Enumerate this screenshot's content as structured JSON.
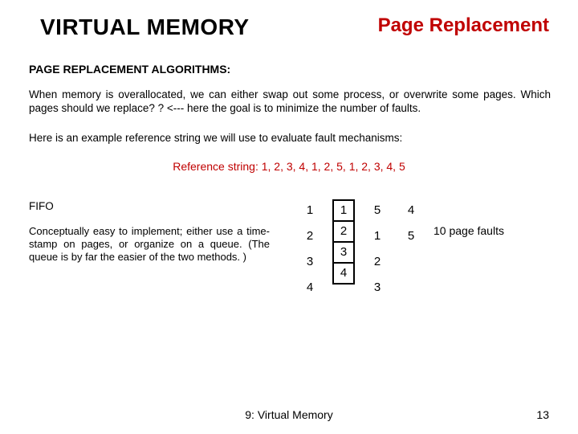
{
  "header": {
    "left": "VIRTUAL MEMORY",
    "right": "Page Replacement"
  },
  "section_heading": "PAGE REPLACEMENT ALGORITHMS:",
  "para1": "When memory is overallocated, we can either swap out some process, or overwrite some pages. Which pages should we replace? ? <--- here the goal is to minimize the number of faults.",
  "para_intro": "Here is an example reference string we will use to evaluate fault mechanisms:",
  "ref_string": "Reference string: 1, 2, 3, 4, 1, 2, 5, 1, 2, 3, 4, 5",
  "fifo": {
    "label": "FIFO",
    "desc": "Conceptually easy to implement; either use a time-stamp on pages, or organize on a queue.   (The queue is by far the easier of the two methods. )"
  },
  "cols": {
    "c0": [
      "1",
      "2",
      "3",
      "4"
    ],
    "c1": [
      "1",
      "2",
      "3",
      "4"
    ],
    "c2": [
      "5",
      "1",
      "2",
      "3"
    ],
    "c3": [
      "4",
      "5",
      "",
      ""
    ]
  },
  "fault_label": "10 page faults",
  "footer_center": "9: Virtual Memory",
  "page_num": "13"
}
